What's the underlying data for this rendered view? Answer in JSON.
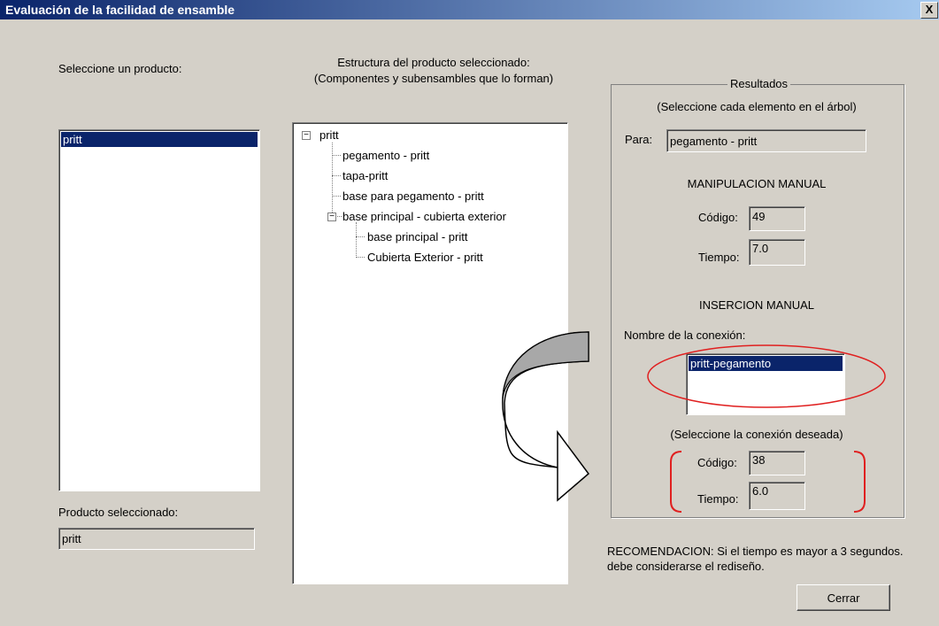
{
  "window": {
    "title": "Evaluación de la facilidad de ensamble",
    "close": "X"
  },
  "products": {
    "label": "Seleccione un producto:",
    "items": [
      "pritt"
    ],
    "selected_label": "Producto seleccionado:",
    "selected_value": "pritt"
  },
  "structure": {
    "title_line1": "Estructura del producto seleccionado:",
    "title_line2": "(Componentes y subensambles que lo forman)",
    "root": "pritt",
    "children": [
      "pegamento - pritt",
      "tapa-pritt",
      "base para pegamento - pritt",
      "base principal - cubierta exterior"
    ],
    "grandchildren": [
      "base principal - pritt",
      "Cubierta Exterior - pritt"
    ],
    "expand_glyph": "−"
  },
  "results": {
    "group_title": "Resultados",
    "hint": "(Seleccione cada elemento en el árbol)",
    "para_label": "Para:",
    "para_value": "pegamento - pritt",
    "manual_handling": {
      "heading": "MANIPULACION MANUAL",
      "code_label": "Código:",
      "code_value": "49",
      "time_label": "Tiempo:",
      "time_value": "7.0"
    },
    "manual_insertion": {
      "heading": "INSERCION MANUAL",
      "connection_label": "Nombre de la conexión:",
      "connections": [
        "pritt-pegamento"
      ],
      "connection_hint": "(Seleccione la conexión deseada)",
      "code_label": "Código:",
      "code_value": "38",
      "time_label": "Tiempo:",
      "time_value": "6.0"
    }
  },
  "recommendation": {
    "line1": "RECOMENDACION: Si el tiempo es mayor a 3 segundos.",
    "line2": "debe considerarse el rediseño."
  },
  "buttons": {
    "close": "Cerrar"
  },
  "colors": {
    "highlight_ellipse": "#e02020",
    "selection": "#0a246a"
  }
}
